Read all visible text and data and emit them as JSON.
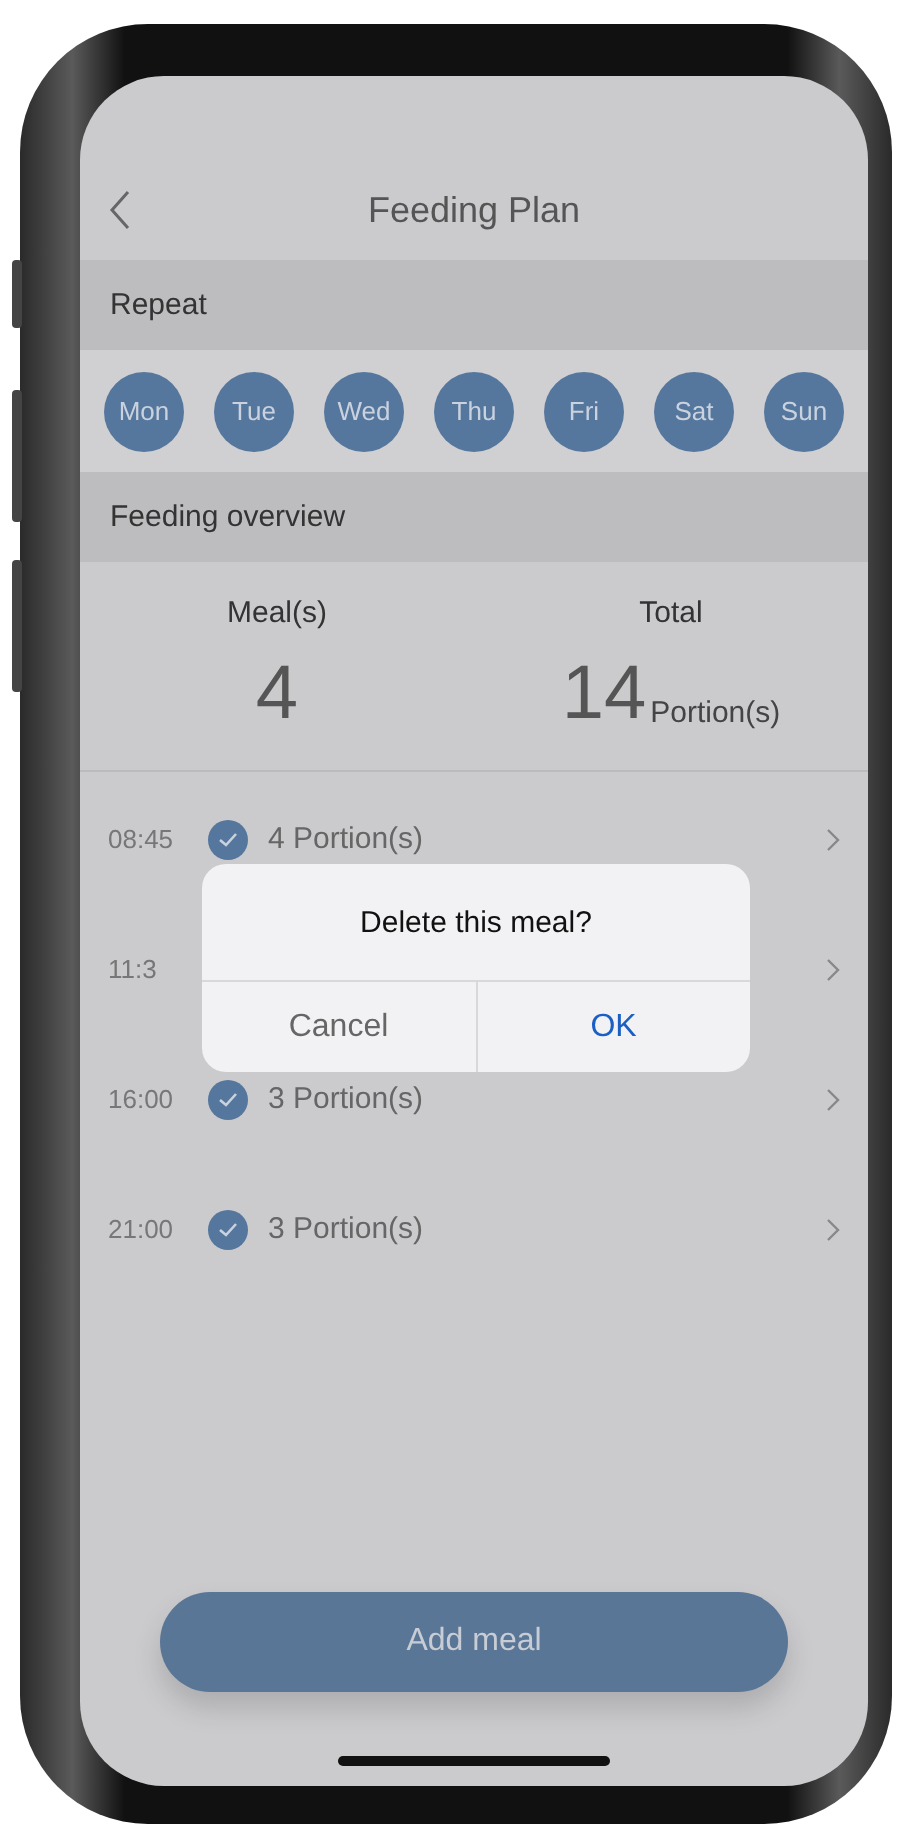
{
  "header": {
    "title": "Feeding Plan"
  },
  "repeat": {
    "label": "Repeat",
    "days": [
      {
        "label": "Mon",
        "selected": true
      },
      {
        "label": "Tue",
        "selected": true
      },
      {
        "label": "Wed",
        "selected": true
      },
      {
        "label": "Thu",
        "selected": true
      },
      {
        "label": "Fri",
        "selected": true
      },
      {
        "label": "Sat",
        "selected": true
      },
      {
        "label": "Sun",
        "selected": true
      }
    ]
  },
  "overview": {
    "label": "Feeding overview",
    "meals_label": "Meal(s)",
    "meals": "4",
    "total_label": "Total",
    "total": "14",
    "total_unit": "Portion(s)"
  },
  "meals": [
    {
      "time": "08:45",
      "portions": "4 Portion(s)"
    },
    {
      "time": "11:3"
    },
    {
      "time": "16:00",
      "portions": "3 Portion(s)"
    },
    {
      "time": "21:00",
      "portions": "3 Portion(s)"
    }
  ],
  "dialog": {
    "message": "Delete this meal?",
    "buttons": [
      {
        "label": "Cancel",
        "kind": "cancel"
      },
      {
        "label": "OK",
        "kind": "confirm"
      }
    ]
  },
  "add_button": {
    "label": "Add meal"
  }
}
